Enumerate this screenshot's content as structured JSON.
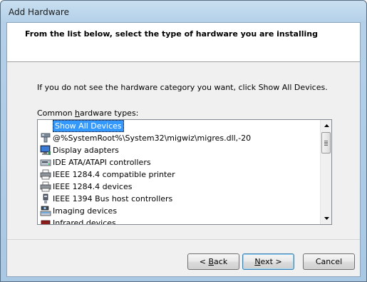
{
  "window": {
    "title": "Add Hardware"
  },
  "header": {
    "title": "From the list below, select the type of hardware you are installing"
  },
  "body": {
    "instruction": "If you do not see the hardware category you want, click Show All Devices.",
    "list_label_pre": "Common ",
    "list_label_accel": "h",
    "list_label_post": "ardware types:"
  },
  "hardware_list": {
    "selected_index": 0,
    "items": [
      {
        "label": "Show All Devices",
        "icon": "none"
      },
      {
        "label": "@%SystemRoot%\\System32\\migwiz\\migres.dll,-20",
        "icon": "migration-device-icon"
      },
      {
        "label": "Display adapters",
        "icon": "monitor-icon"
      },
      {
        "label": "IDE ATA/ATAPI controllers",
        "icon": "ide-controller-icon"
      },
      {
        "label": "IEEE 1284.4 compatible printer",
        "icon": "printer-icon"
      },
      {
        "label": "IEEE 1284.4 devices",
        "icon": "printer-icon"
      },
      {
        "label": "IEEE 1394 Bus host controllers",
        "icon": "firewire-icon"
      },
      {
        "label": "Imaging devices",
        "icon": "camera-scanner-icon"
      },
      {
        "label": "Infrared devices",
        "icon": "infrared-icon"
      }
    ]
  },
  "buttons": {
    "back_accel": "B",
    "back_rest": "ack",
    "back_prefix": "< ",
    "next_accel": "N",
    "next_rest": "ext >",
    "cancel": "Cancel"
  }
}
